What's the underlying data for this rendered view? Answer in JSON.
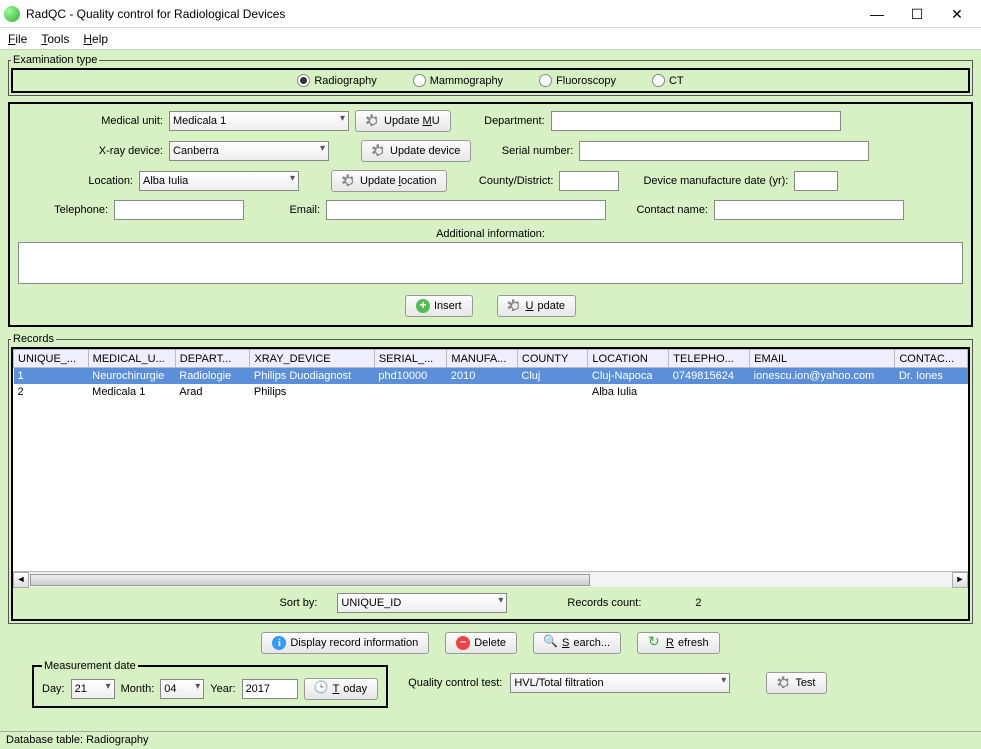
{
  "window": {
    "title": "RadQC - Quality control for Radiological Devices"
  },
  "menu": {
    "file": "File",
    "tools": "Tools",
    "help": "Help"
  },
  "exam": {
    "legend": "Examination type",
    "options": {
      "radiography": "Radiography",
      "mammography": "Mammography",
      "fluoroscopy": "Fluoroscopy",
      "ct": "CT"
    },
    "selected": "radiography"
  },
  "form": {
    "medical_unit_lbl": "Medical unit:",
    "medical_unit_val": "Medicala 1",
    "update_mu": "Update MU",
    "department_lbl": "Department:",
    "department_val": "",
    "xray_lbl": "X-ray device:",
    "xray_val": "Canberra",
    "update_device": "Update device",
    "serial_lbl": "Serial number:",
    "serial_val": "",
    "location_lbl": "Location:",
    "location_val": "Alba Iulia",
    "update_location": "Update location",
    "county_lbl": "County/District:",
    "county_val": "",
    "mfg_date_lbl": "Device manufacture date (yr):",
    "mfg_date_val": "",
    "telephone_lbl": "Telephone:",
    "telephone_val": "",
    "email_lbl": "Email:",
    "email_val": "",
    "contact_lbl": "Contact name:",
    "contact_val": "",
    "additional_lbl": "Additional information:",
    "additional_val": "",
    "insert": "Insert",
    "update": "Update"
  },
  "records": {
    "legend": "Records",
    "headers": [
      "UNIQUE_...",
      "MEDICAL_U...",
      "DEPART...",
      "XRAY_DEVICE",
      "SERIAL_...",
      "MANUFA...",
      "COUNTY",
      "LOCATION",
      "TELEPHO...",
      "EMAIL",
      "CONTAC..."
    ],
    "rows": [
      {
        "id": "1",
        "mu": "Neurochirurgie",
        "dep": "Radiologie",
        "xd": "Philips Duodiagnost",
        "sn": "phd10000",
        "mfg": "2010",
        "county": "Cluj",
        "loc": "Cluj-Napoca",
        "tel": "0749815624",
        "email": "ionescu.ion@yahoo.com",
        "contact": "Dr. Iones"
      },
      {
        "id": "2",
        "mu": "Medicala 1",
        "dep": "Arad",
        "xd": "Philips",
        "sn": "",
        "mfg": "",
        "county": "",
        "loc": "Alba Iulia",
        "tel": "",
        "email": "",
        "contact": ""
      }
    ],
    "sort_lbl": "Sort by:",
    "sort_val": "UNIQUE_ID",
    "count_lbl": "Records count:",
    "count_val": "2"
  },
  "actions": {
    "display": "Display record information",
    "delete": "Delete",
    "search": "Search...",
    "refresh": "Refresh"
  },
  "measure": {
    "legend": "Measurement date",
    "day_lbl": "Day:",
    "day_val": "21",
    "month_lbl": "Month:",
    "month_val": "04",
    "year_lbl": "Year:",
    "year_val": "2017",
    "today": "Today"
  },
  "qc": {
    "test_lbl": "Quality control test:",
    "test_val": "HVL/Total filtration",
    "test_btn": "Test"
  },
  "status": "Database table: Radiography"
}
